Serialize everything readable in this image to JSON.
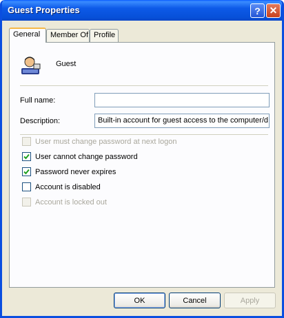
{
  "window": {
    "title": "Guest Properties",
    "help_glyph": "?",
    "close_glyph": "✕"
  },
  "tabs": [
    {
      "label": "General",
      "active": true
    },
    {
      "label": "Member Of",
      "active": false
    },
    {
      "label": "Profile",
      "active": false
    }
  ],
  "user": {
    "name": "Guest",
    "icon": "user-account-icon"
  },
  "fields": {
    "full_name": {
      "label": "Full name:",
      "value": ""
    },
    "description": {
      "label": "Description:",
      "value": "Built-in account for guest access to the computer/d"
    }
  },
  "checkboxes": [
    {
      "label": "User must change password at next logon",
      "checked": false,
      "enabled": false
    },
    {
      "label": "User cannot change password",
      "checked": true,
      "enabled": true
    },
    {
      "label": "Password never expires",
      "checked": true,
      "enabled": true
    },
    {
      "label": "Account is disabled",
      "checked": false,
      "enabled": true
    },
    {
      "label": "Account is locked out",
      "checked": false,
      "enabled": false
    }
  ],
  "buttons": {
    "ok": "OK",
    "cancel": "Cancel",
    "apply": "Apply"
  },
  "colors": {
    "titlebar": "#0a5dff",
    "dialog_bg": "#ece9d8",
    "tab_accent": "#f6b846"
  }
}
